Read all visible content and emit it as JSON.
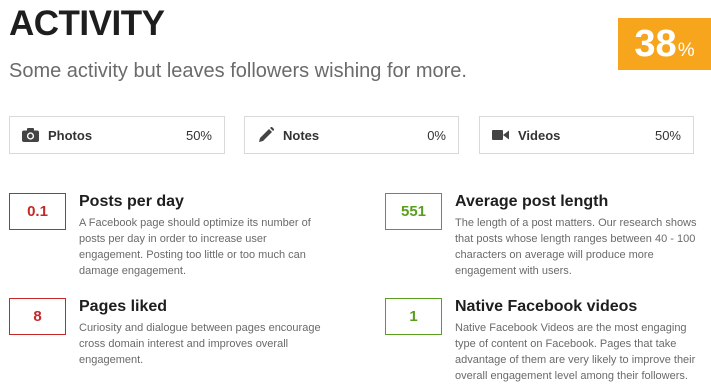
{
  "header": {
    "title": "ACTIVITY",
    "subtitle": "Some activity but leaves followers wishing for more.",
    "score_value": "38",
    "score_unit": "%",
    "score_color": "#f7a51c"
  },
  "media": [
    {
      "icon": "camera-icon",
      "label": "Photos",
      "value": "50%"
    },
    {
      "icon": "pencil-icon",
      "label": "Notes",
      "value": "0%"
    },
    {
      "icon": "video-camera-icon",
      "label": "Videos",
      "value": "50%"
    }
  ],
  "metrics": [
    {
      "value": "0.1",
      "title": "Posts per day",
      "status": "red",
      "description": "A Facebook page should optimize its number of posts per day in order to increase user engagement. Posting too little or too much can damage engagement."
    },
    {
      "value": "551",
      "title": "Average post length",
      "status": "green",
      "description": "The length of a post matters. Our research shows that posts whose length ranges between 40 - 100 characters on average will produce more engagement with users."
    },
    {
      "value": "8",
      "title": "Pages liked",
      "status": "red",
      "description": "Curiosity and dialogue between pages encourage cross domain interest and improves overall engagement."
    },
    {
      "value": "1",
      "title": "Native Facebook videos",
      "status": "green",
      "description": "Native Facebook Videos are the most engaging type of content on Facebook. Pages that take advantage of them are very likely to improve their overall engagement level among their followers."
    }
  ],
  "colors": {
    "bad": "#c62828",
    "good": "#8bc34a",
    "score": "#f7a51c"
  }
}
